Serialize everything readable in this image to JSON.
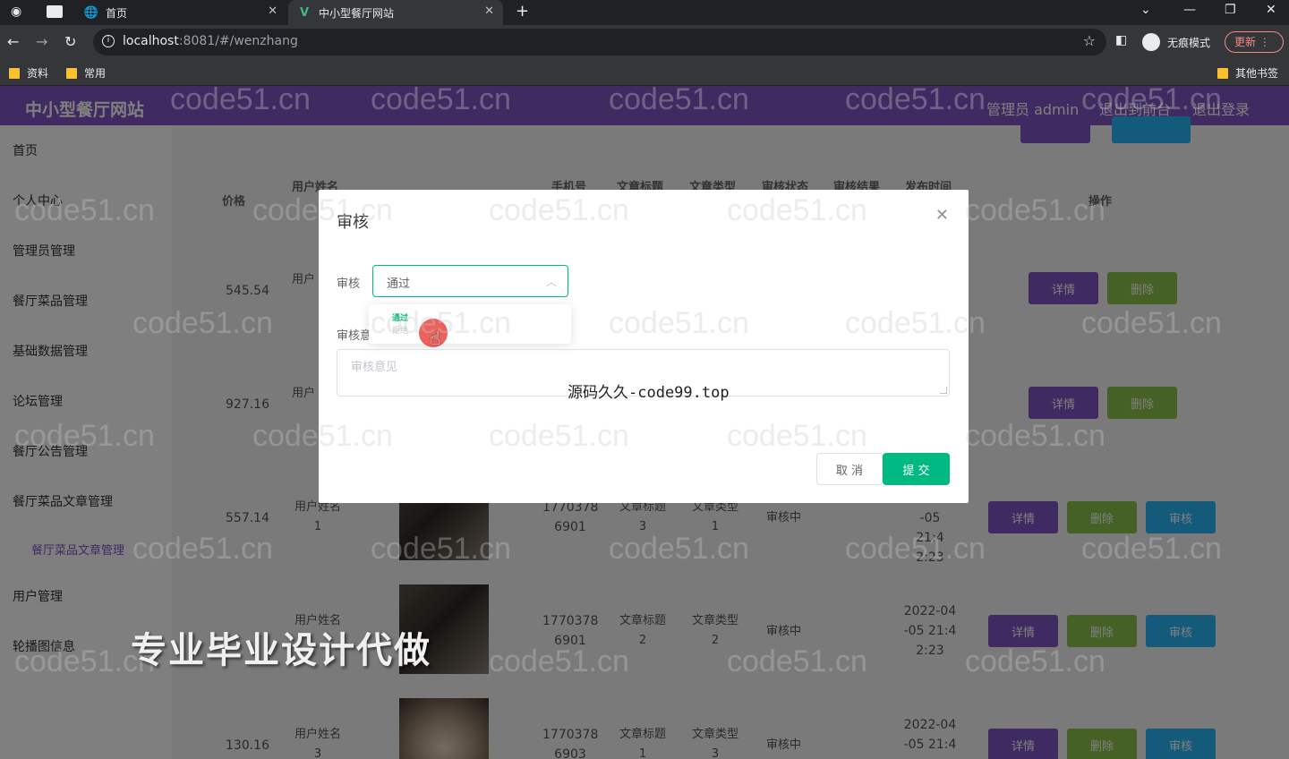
{
  "browser": {
    "tabs": [
      {
        "label": "首页",
        "icon": "globe-icon"
      },
      {
        "label": "中小型餐厅网站",
        "icon": "vue-logo-icon"
      }
    ],
    "url_host": "localhost",
    "url_rest": ":8081/#/wenzhang",
    "incognito_label": "无痕模式",
    "update_label": "更新",
    "bookmarks": [
      "资料",
      "常用"
    ],
    "other_bookmarks": "其他书签"
  },
  "app": {
    "title": "中小型餐厅网站",
    "header_links": [
      "管理员 admin",
      "退出到前台",
      "退出登录"
    ]
  },
  "sidebar": {
    "items": [
      "首页",
      "个人中心",
      "管理员管理",
      "餐厅菜品管理",
      "基础数据管理",
      "论坛管理",
      "餐厅公告管理",
      "餐厅菜品文章管理",
      "用户管理",
      "轮播图信息"
    ],
    "sub_item": "餐厅菜品文章管理"
  },
  "table": {
    "headers": {
      "price": "价格",
      "username": "用户姓名",
      "phone": "手机号",
      "title": "文章标题",
      "type": "文章类型",
      "status": "审核状态",
      "result": "审核结果",
      "time": "发布时间",
      "ops": "操作"
    },
    "rows": [
      {
        "price": "545.54",
        "user": "用户",
        "phone": "",
        "title": "",
        "type": "",
        "status": "",
        "time": ""
      },
      {
        "price": "927.16",
        "user": "用户",
        "phone": "",
        "title": "",
        "type": "",
        "status": "",
        "time": ""
      },
      {
        "price": "557.14",
        "user": "用户姓名 1",
        "phone": "1770378 6901",
        "title": "文章标题 3",
        "type": "文章类型 1",
        "status": "审核中",
        "time": "-05 21:4 2:23"
      },
      {
        "price": "",
        "user": "用户姓名",
        "phone": "1770378 6901",
        "title": "文章标题 2",
        "type": "文章类型 2",
        "status": "审核中",
        "time": "2022-04 -05 21:4 2:23"
      },
      {
        "price": "130.16",
        "user": "用户姓名 3",
        "phone": "1770378 6903",
        "title": "文章标题 1",
        "type": "文章类型 3",
        "status": "审核中",
        "time": "2022-04 -05 21:4"
      }
    ],
    "btn_detail": "详情",
    "btn_delete": "删除",
    "btn_audit": "审核"
  },
  "modal": {
    "title": "审核",
    "audit_label": "审核",
    "audit_value": "通过",
    "dropdown_options": [
      "通过",
      "拒绝"
    ],
    "opinion_label": "审核意见",
    "opinion_placeholder": "审核意见",
    "cancel_label": "取 消",
    "submit_label": "提 交"
  },
  "watermarks": {
    "site": "code51.cn",
    "center": "源码久久-code99.top",
    "ad": "专业毕业设计代做"
  },
  "colors": {
    "header": "#7e57c2",
    "primary": "#00b882",
    "detail": "#7e57c2",
    "delete": "#8bc34a",
    "audit": "#29b6f6"
  }
}
